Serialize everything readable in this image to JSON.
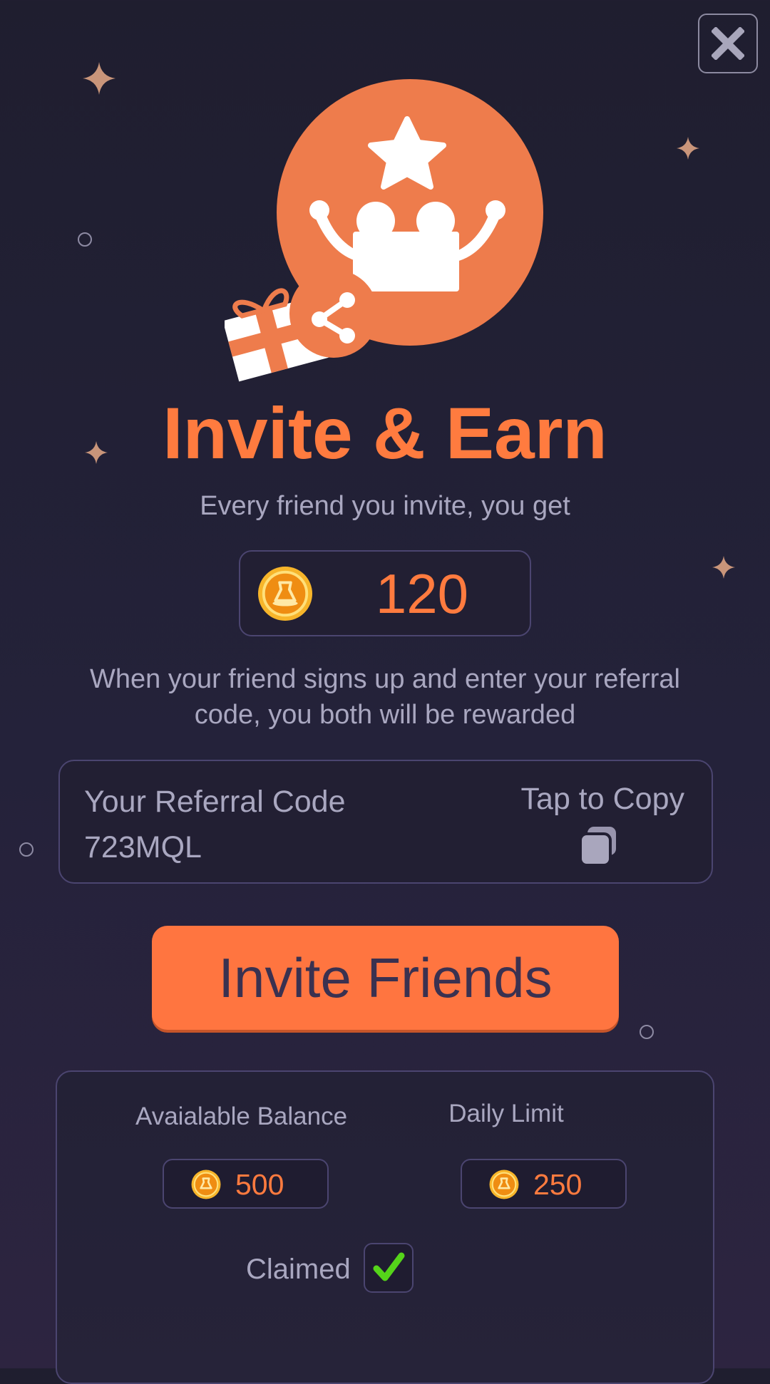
{
  "header": {
    "close_icon": "close-icon"
  },
  "hero": {
    "title": "Invite & Earn",
    "subtitle": "Every friend you invite, you get",
    "reward_amount": "120",
    "coin_icon": "coin-icon",
    "description": "When your friend signs up and enter your referral code, you both will be rewarded"
  },
  "referral": {
    "label": "Your Referral Code",
    "code": "723MQL",
    "copy_label": "Tap to Copy",
    "copy_icon": "copy-icon"
  },
  "invite_button": {
    "label": "Invite Friends"
  },
  "stats": {
    "available_balance_label": "Avaialable Balance",
    "available_balance_value": "500",
    "daily_limit_label": "Daily Limit",
    "daily_limit_value": "250",
    "claimed_label": "Claimed",
    "claimed_checked": true
  },
  "colors": {
    "background": "#1f1e2f",
    "accent": "#ff7540",
    "text_muted": "#a9a7c0",
    "border": "#4b4570",
    "check": "#55d41a"
  }
}
